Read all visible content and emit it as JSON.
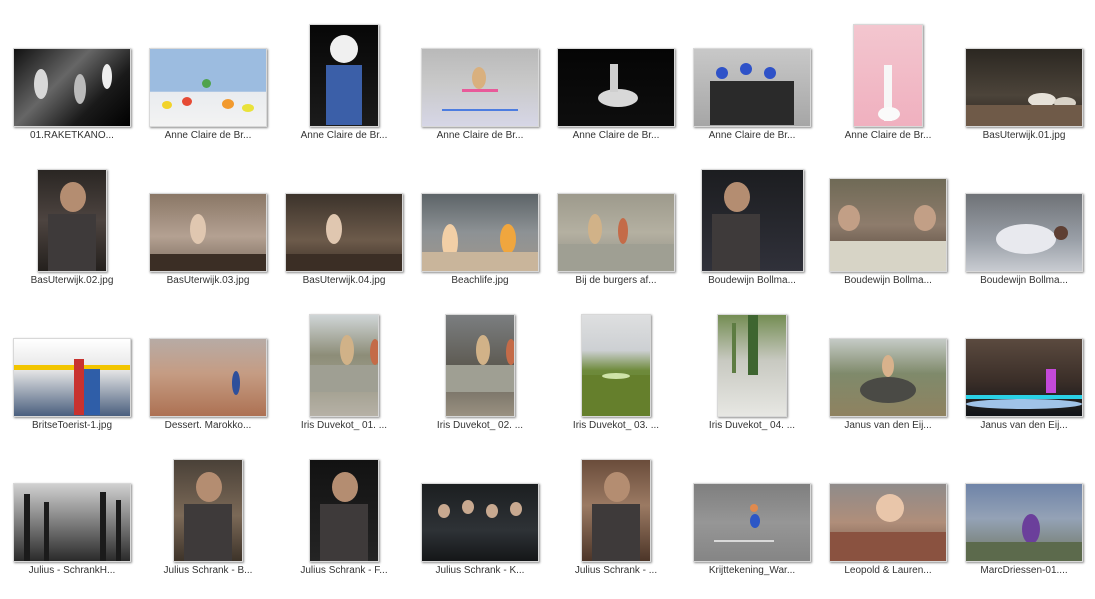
{
  "files": [
    {
      "caption": "01.RAKETKANO...",
      "w": 116,
      "h": 77,
      "bg": "linear-gradient(135deg,#111 0%,#666 40%,#1a1a1a 70%,#000 100%)",
      "icon": "photo-band-icon"
    },
    {
      "caption": "Anne Claire de Br...",
      "w": 116,
      "h": 77,
      "bg": "linear-gradient(180deg,#9cbce0 0%,#9cbce0 55%,#e9ecef 56%,#f3f3f3 100%)",
      "icon": "photo-fruit-icon"
    },
    {
      "caption": "Anne Claire de Br...",
      "w": 68,
      "h": 101,
      "bg": "linear-gradient(180deg,#070707 0%,#1b1b1b 100%)",
      "icon": "photo-dog-icon"
    },
    {
      "caption": "Anne Claire de Br...",
      "w": 116,
      "h": 77,
      "bg": "linear-gradient(180deg,#b9b9b9 0%,#c9c9c9 45%,#d6d6e6 100%)",
      "icon": "photo-gymnast-icon"
    },
    {
      "caption": "Anne Claire de Br...",
      "w": 116,
      "h": 77,
      "bg": "linear-gradient(180deg,#050505 0%,#0e0e0e 100%)",
      "icon": "photo-horse-icon"
    },
    {
      "caption": "Anne Claire de Br...",
      "w": 116,
      "h": 77,
      "bg": "linear-gradient(180deg,#c8c8c8 0%,#a6a6a6 100%)",
      "icon": "photo-band-blue-icon"
    },
    {
      "caption": "Anne Claire de Br...",
      "w": 68,
      "h": 101,
      "bg": "linear-gradient(180deg,#f3c6cf 0%,#f0b0bf 100%)",
      "icon": "photo-vase-icon"
    },
    {
      "caption": "BasUterwijk.01.jpg",
      "w": 116,
      "h": 77,
      "bg": "linear-gradient(180deg,#2b2721 0%,#4c443a 60%,#2a241e 100%)",
      "icon": "photo-dogs-icon"
    },
    {
      "caption": "BasUterwijk.02.jpg",
      "w": 68,
      "h": 101,
      "bg": "linear-gradient(180deg,#2a2623 0%,#4d4440 50%,#24201d 100%)",
      "icon": "photo-portrait-icon"
    },
    {
      "caption": "BasUterwijk.03.jpg",
      "w": 116,
      "h": 77,
      "bg": "linear-gradient(180deg,#8a7766 0%,#b4a192 55%,#7a6a5d 100%)",
      "icon": "photo-room-icon"
    },
    {
      "caption": "BasUterwijk.04.jpg",
      "w": 116,
      "h": 77,
      "bg": "linear-gradient(180deg,#3c332b 0%,#6d5b4b 60%,#3b2f26 100%)",
      "icon": "photo-room-icon"
    },
    {
      "caption": "Beachlife.jpg",
      "w": 116,
      "h": 77,
      "bg": "linear-gradient(180deg,#5d6468 0%,#8d9295 50%,#a0978c 100%)",
      "icon": "photo-beach-icon"
    },
    {
      "caption": "Bij de burgers af...",
      "w": 116,
      "h": 77,
      "bg": "linear-gradient(180deg,#9d9a8c 0%,#b4b0a1 50%,#8c8c82 100%)",
      "icon": "photo-street-icon"
    },
    {
      "caption": "Boudewijn Bollma...",
      "w": 101,
      "h": 101,
      "bg": "linear-gradient(180deg,#1c1d20 0%,#30313a 100%)",
      "icon": "photo-portrait-icon"
    },
    {
      "caption": "Boudewijn Bollma...",
      "w": 116,
      "h": 92,
      "bg": "linear-gradient(180deg,#6f6a56 0%,#8e7c6c 50%,#4d3f34 100%)",
      "icon": "photo-table-icon"
    },
    {
      "caption": "Boudewijn Bollma...",
      "w": 116,
      "h": 77,
      "bg": "linear-gradient(180deg,#6f7277 0%,#9aa0a8 60%,#c8cbd1 100%)",
      "icon": "photo-sleep-icon"
    },
    {
      "caption": "BritseToerist-1.jpg",
      "w": 116,
      "h": 77,
      "bg": "linear-gradient(180deg,#ffffff 0%,#e6e6e6 40%,#4a5f7e 100%)",
      "icon": "photo-tourist-icon"
    },
    {
      "caption": "Dessert. Marokko...",
      "w": 116,
      "h": 77,
      "bg": "linear-gradient(180deg,#b7aba5 0%,#c59c83 45%,#ad7153 100%)",
      "icon": "photo-desert-icon"
    },
    {
      "caption": "Iris Duvekot_ 01. ...",
      "w": 68,
      "h": 101,
      "bg": "linear-gradient(180deg,#cfd5d6 0%,#8d8d78 40%,#b6b1a6 100%)",
      "icon": "photo-street-icon"
    },
    {
      "caption": "Iris Duvekot_ 02. ...",
      "w": 68,
      "h": 101,
      "bg": "linear-gradient(180deg,#7b7e80 0%,#5e5b53 50%,#9a9181 100%)",
      "icon": "photo-street-icon"
    },
    {
      "caption": "Iris Duvekot_ 03. ...",
      "w": 68,
      "h": 101,
      "bg": "linear-gradient(180deg,#dedfe0 0%,#cdd0d3 35%,#6e8a3b 55%,#5e7d2e 100%)",
      "icon": "photo-field-icon"
    },
    {
      "caption": "Iris Duvekot_ 04. ...",
      "w": 68,
      "h": 101,
      "bg": "linear-gradient(180deg,#748d53 0%,#c8c9c1 45%,#e7e7e3 100%)",
      "icon": "photo-plant-icon"
    },
    {
      "caption": "Janus van den Eij...",
      "w": 116,
      "h": 77,
      "bg": "linear-gradient(180deg,#c5cbc6 0%,#7f8a6b 45%,#8f8260 100%)",
      "icon": "photo-buffalo-icon"
    },
    {
      "caption": "Janus van den Eij...",
      "w": 116,
      "h": 77,
      "bg": "linear-gradient(180deg,#5b4a3f 0%,#3a2e28 55%,#111418 100%)",
      "icon": "photo-lights-icon"
    },
    {
      "caption": "Julius - SchrankH...",
      "w": 116,
      "h": 77,
      "bg": "linear-gradient(180deg,#d0d0d0 0%,#7e7e7e 50%,#2a2a2a 100%)",
      "icon": "photo-forest-icon"
    },
    {
      "caption": "Julius Schrank - B...",
      "w": 68,
      "h": 101,
      "bg": "linear-gradient(180deg,#4a4138 0%,#7b6957 55%,#3d3329 100%)",
      "icon": "photo-portrait-icon"
    },
    {
      "caption": "Julius Schrank - F...",
      "w": 68,
      "h": 101,
      "bg": "linear-gradient(180deg,#121212 0%,#242424 100%)",
      "icon": "photo-portrait-icon"
    },
    {
      "caption": "Julius Schrank - K...",
      "w": 116,
      "h": 77,
      "bg": "linear-gradient(180deg,#1c1f21 0%,#2e3236 60%,#141618 100%)",
      "icon": "photo-group-icon"
    },
    {
      "caption": "Julius Schrank - ...",
      "w": 68,
      "h": 101,
      "bg": "linear-gradient(180deg,#6a4c3b 0%,#9b7a63 45%,#4c3528 100%)",
      "icon": "photo-portrait-icon"
    },
    {
      "caption": "Krijttekening_War...",
      "w": 116,
      "h": 77,
      "bg": "linear-gradient(180deg,#7f7f7f 0%,#969696 50%,#858585 100%)",
      "icon": "photo-chalk-icon"
    },
    {
      "caption": "Leopold & Lauren...",
      "w": 116,
      "h": 77,
      "bg": "linear-gradient(180deg,#8f8b8a 0%,#b08e7a 50%,#6a4f40 100%)",
      "icon": "photo-baby-icon"
    },
    {
      "caption": "MarcDriessen-01....",
      "w": 116,
      "h": 77,
      "bg": "linear-gradient(180deg,#6f84a8 0%,#94a2b6 45%,#6f7660 100%)",
      "icon": "photo-woman-icon"
    }
  ]
}
